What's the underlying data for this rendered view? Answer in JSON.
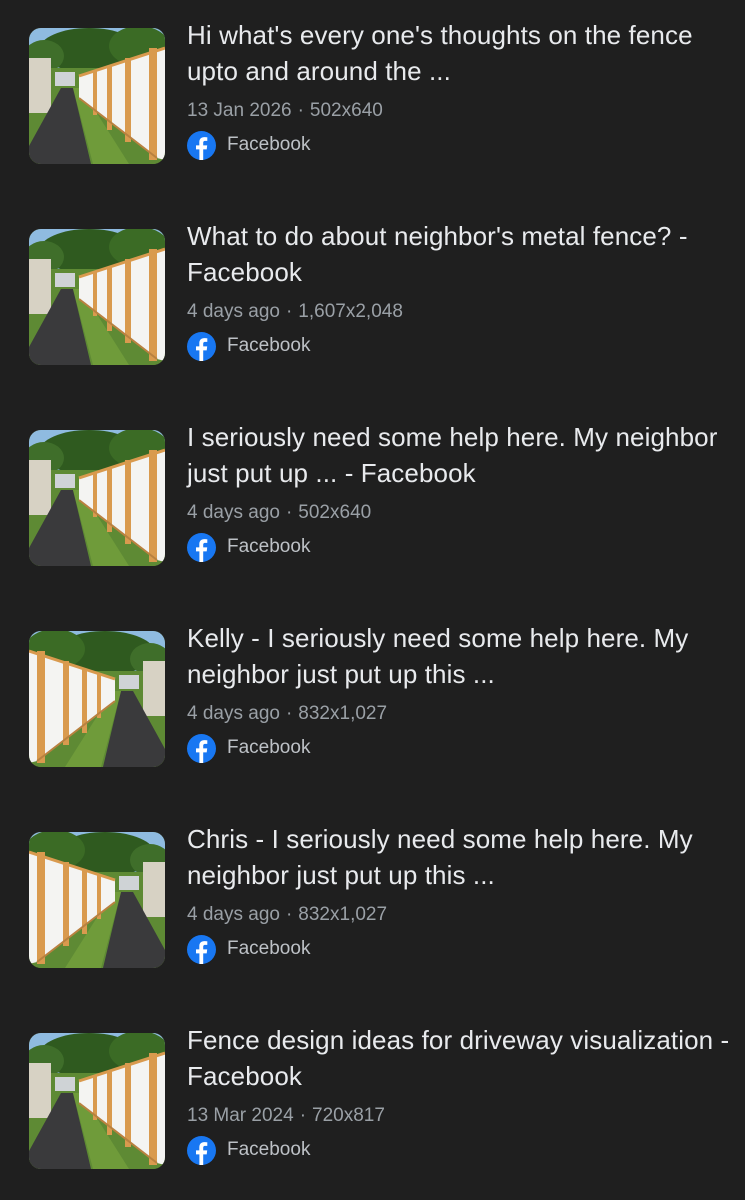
{
  "results": [
    {
      "title": "Hi what's every one's thoughts on the fence upto and around the ...",
      "date": "13 Jan 2026",
      "separator": "·",
      "dimensions": "502x640",
      "source": "Facebook",
      "source_icon": "facebook-icon"
    },
    {
      "title": "What to do about neighbor's metal fence? - Facebook",
      "date": "4 days ago",
      "separator": "·",
      "dimensions": "1,607x2,048",
      "source": "Facebook",
      "source_icon": "facebook-icon"
    },
    {
      "title": "I seriously need some help here. My neighbor just put up ... - Facebook",
      "date": "4 days ago",
      "separator": "·",
      "dimensions": "502x640",
      "source": "Facebook",
      "source_icon": "facebook-icon"
    },
    {
      "title": "Kelly - I seriously need some help here. My neighbor just put up this ...",
      "date": "4 days ago",
      "separator": "·",
      "dimensions": "832x1,027",
      "source": "Facebook",
      "source_icon": "facebook-icon"
    },
    {
      "title": "Chris - I seriously need some help here. My neighbor just put up this ...",
      "date": "4 days ago",
      "separator": "·",
      "dimensions": "832x1,027",
      "source": "Facebook",
      "source_icon": "facebook-icon"
    },
    {
      "title": "Fence design ideas for driveway visualization - Facebook",
      "date": "13 Mar 2024",
      "separator": "·",
      "dimensions": "720x817",
      "source": "Facebook",
      "source_icon": "facebook-icon"
    }
  ],
  "colors": {
    "background": "#1f1f1f",
    "title": "#e8eaed",
    "meta": "#9aa0a6",
    "facebook_blue": "#1877f2"
  }
}
